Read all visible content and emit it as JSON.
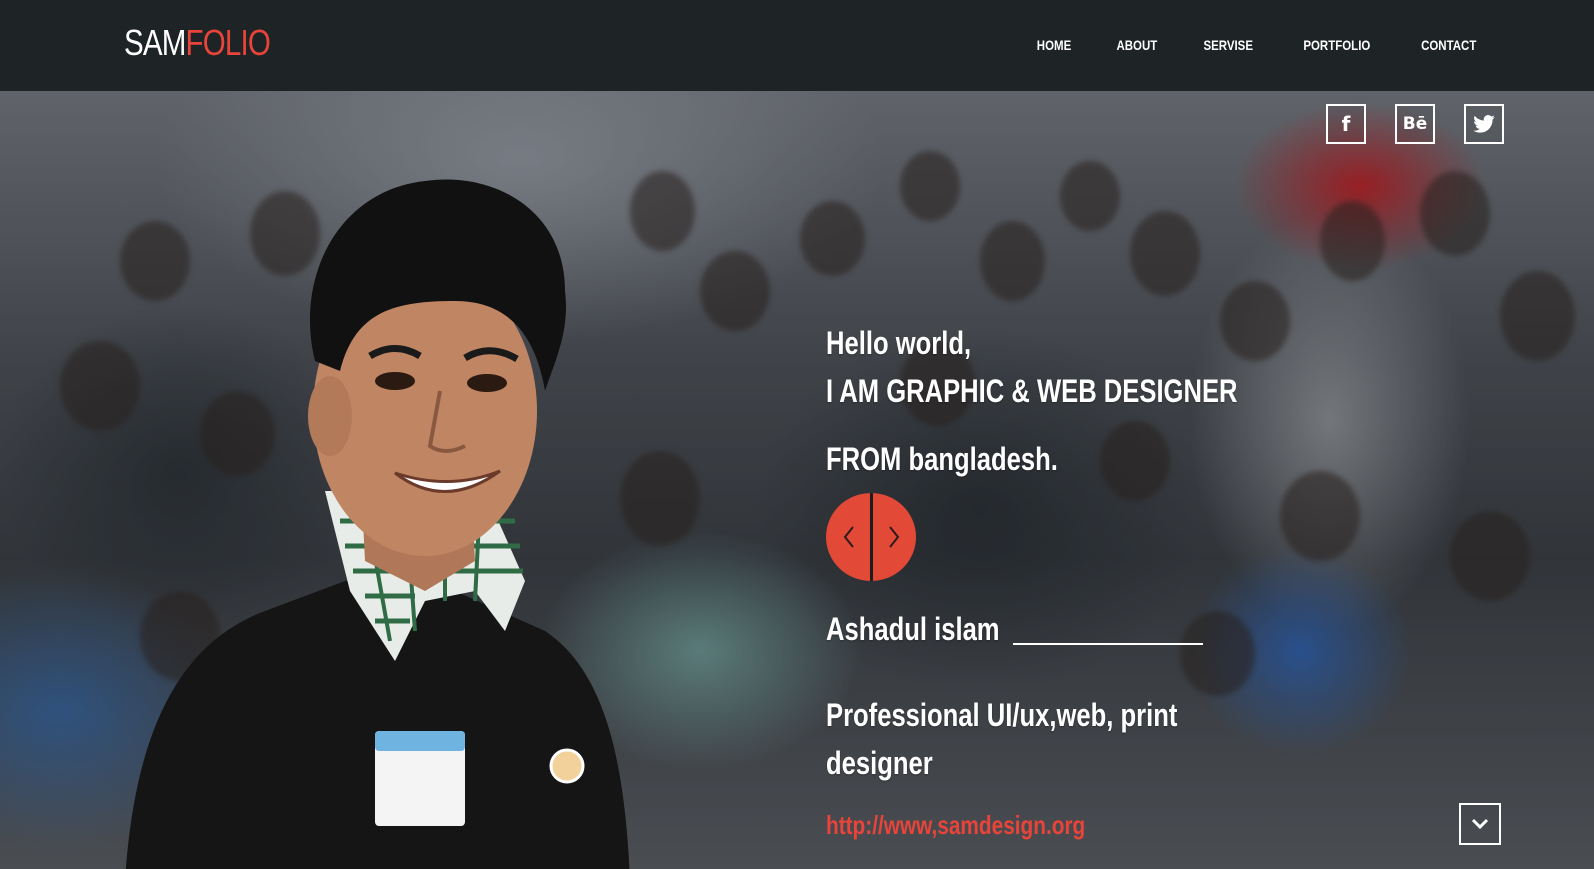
{
  "brand": {
    "logo_part1": "SAM",
    "logo_part2": "FOLIO",
    "accent_color": "#e8443a"
  },
  "nav": {
    "items": [
      {
        "label": "HOME"
      },
      {
        "label": "ABOUT"
      },
      {
        "label": "SERVISE"
      },
      {
        "label": "PORTFOLIO"
      },
      {
        "label": "CONTACT"
      }
    ]
  },
  "social": {
    "facebook": {
      "icon": "facebook-icon",
      "glyph": "f"
    },
    "behance": {
      "icon": "behance-icon",
      "glyph": "Bē"
    },
    "twitter": {
      "icon": "twitter-icon"
    }
  },
  "hero": {
    "greeting": "Hello world,",
    "headline": "I AM GRAPHIC & WEB DESIGNER",
    "from": "FROM bangladesh.",
    "name": "Ashadul islam",
    "role": "Professional UI/ux,web, print designer",
    "link": "http://www,samdesign.org",
    "slider_prev_icon": "chevron-left-icon",
    "slider_next_icon": "chevron-right-icon",
    "scroll_icon": "chevron-down-icon"
  }
}
